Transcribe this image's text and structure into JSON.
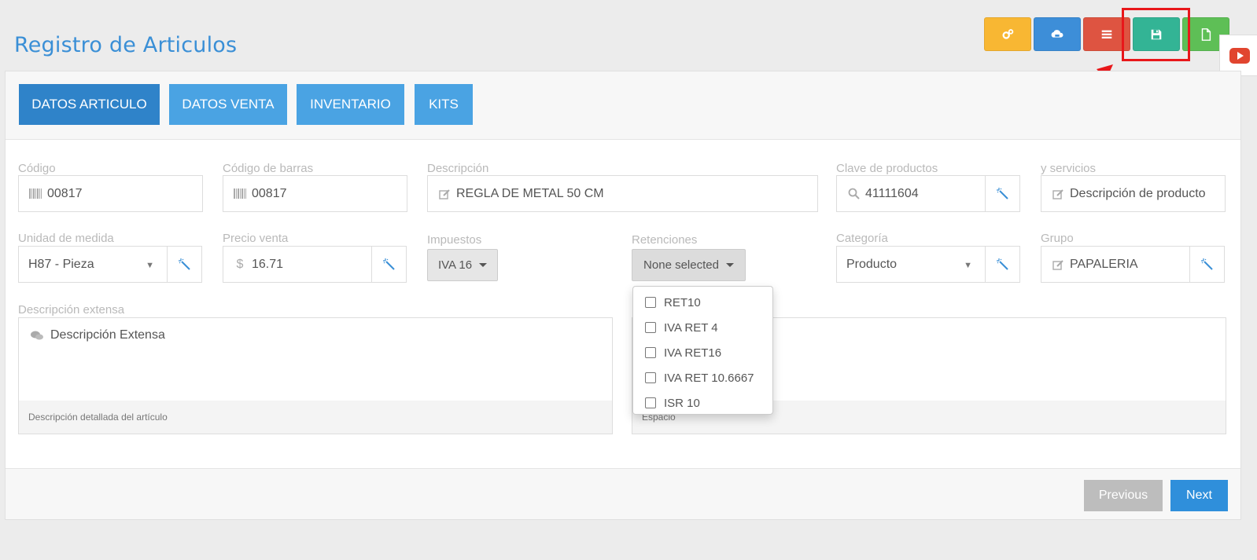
{
  "page": {
    "title": "Registro de Articulos"
  },
  "toolbar": {
    "buttons": [
      {
        "name": "settings",
        "color": "#f8b733",
        "icon": "gears-icon"
      },
      {
        "name": "cloud",
        "color": "#3d8ed8",
        "icon": "cloud-car-icon"
      },
      {
        "name": "list",
        "color": "#de5441",
        "icon": "list-icon"
      },
      {
        "name": "save",
        "color": "#33b495",
        "icon": "save-icon"
      },
      {
        "name": "new",
        "color": "#5ebf56",
        "icon": "file-icon"
      }
    ]
  },
  "side_tab": {
    "icon": "youtube-icon"
  },
  "tabs": [
    {
      "label": "DATOS ARTICULO",
      "active": true
    },
    {
      "label": "DATOS VENTA",
      "active": false
    },
    {
      "label": "INVENTARIO",
      "active": false
    },
    {
      "label": "KITS",
      "active": false
    }
  ],
  "fields": {
    "codigo": {
      "label": "Código",
      "value": "00817"
    },
    "codigo_barras": {
      "label": "Código de barras",
      "value": "00817"
    },
    "descripcion": {
      "label": "Descripción",
      "value": "REGLA DE METAL 50 CM"
    },
    "clave_productos": {
      "label": "Clave de productos",
      "value": "41111604"
    },
    "servicios": {
      "label": "y servicios",
      "placeholder": "Descripción de producto"
    },
    "unidad_medida": {
      "label": "Unidad de medida",
      "value": "H87 - Pieza"
    },
    "precio_venta": {
      "label": "Precio venta",
      "value": "16.71"
    },
    "impuestos": {
      "label": "Impuestos",
      "value": "IVA 16"
    },
    "retenciones": {
      "label": "Retenciones",
      "value": "None selected",
      "options": [
        "RET10",
        "IVA RET 4",
        "IVA RET16",
        "IVA RET 10.6667",
        "ISR 10"
      ]
    },
    "categoria": {
      "label": "Categoría",
      "value": "Producto"
    },
    "grupo": {
      "label": "Grupo",
      "value": "PAPALERIA"
    },
    "descripcion_extensa": {
      "label": "Descripción extensa",
      "placeholder": "Descripción Extensa",
      "help": "Descripción detallada del artículo"
    },
    "espacio": {
      "help": "Espacio"
    }
  },
  "footer": {
    "previous": "Previous",
    "next": "Next"
  }
}
